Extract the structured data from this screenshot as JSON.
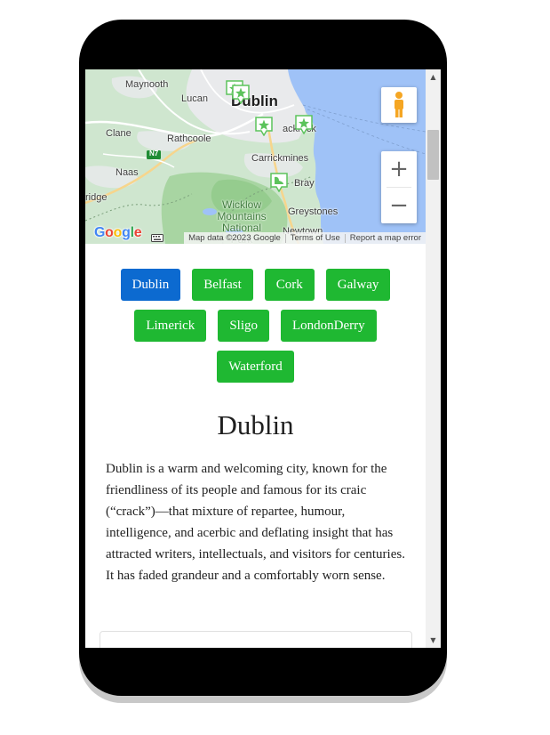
{
  "map": {
    "places": {
      "maynooth": "Maynooth",
      "lucan": "Lucan",
      "dublin": "Dublin",
      "clane": "Clane",
      "rathcoole": "Rathcoole",
      "blackrock": "ackrock",
      "carrickmines": "Carrickmines",
      "naas": "Naas",
      "bray": "Bray",
      "bridge": "ridge",
      "wicklow_park": "Wicklow Mountains National Park",
      "greystones": "Greystones",
      "newtown": "Newtown",
      "road_n7": "N7"
    },
    "google_logo": "Google",
    "attribution": {
      "map_data": "Map data ©2023 Google",
      "terms": "Terms of Use",
      "report": "Report a map error"
    },
    "controls": {
      "zoom_in": "+",
      "zoom_out": "−"
    },
    "colors": {
      "water": "#9fc2f7",
      "land": "#cfe6cf",
      "urban": "#e9eaec",
      "park": "#a8d5a2",
      "marker": "#5cc35c"
    }
  },
  "cities": {
    "buttons": [
      {
        "label": "Dublin",
        "active": true
      },
      {
        "label": "Belfast",
        "active": false
      },
      {
        "label": "Cork",
        "active": false
      },
      {
        "label": "Galway",
        "active": false
      },
      {
        "label": "Limerick",
        "active": false
      },
      {
        "label": "Sligo",
        "active": false
      },
      {
        "label": "LondonDerry",
        "active": false
      },
      {
        "label": "Waterford",
        "active": false
      }
    ],
    "colors": {
      "default": "#1fb832",
      "active": "#0c6ad0"
    }
  },
  "selected": {
    "title": "Dublin",
    "description": "Dublin is a warm and welcoming city, known for the friendliness of its people and famous for its craic (“crack”)—that mixture of repartee, humour, intelligence, and acerbic and deflating insight that has attracted writers, intellectuals, and visitors for centuries. It has faded grandeur and a comfortably worn sense."
  },
  "scrollbar": {
    "up_arrow": "▲",
    "down_arrow": "▼"
  }
}
